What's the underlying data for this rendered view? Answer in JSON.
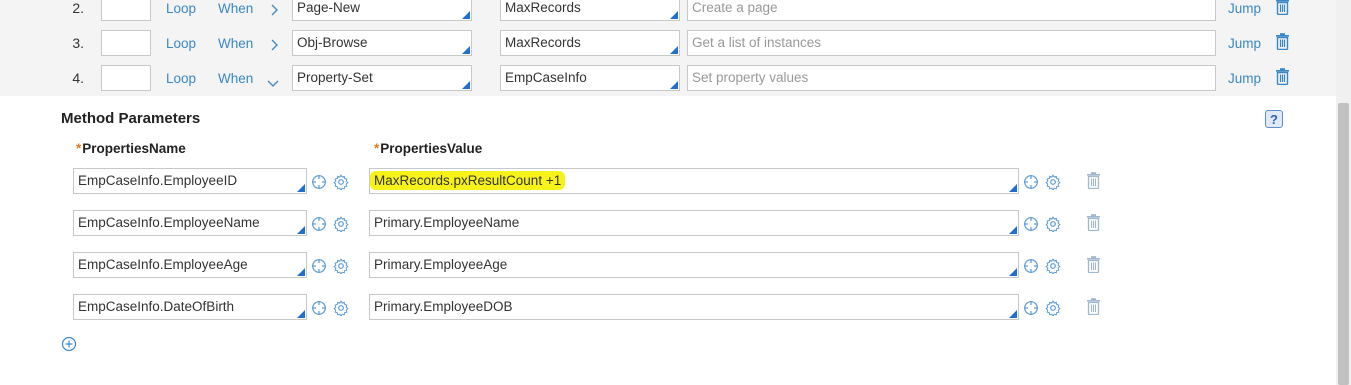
{
  "steps": [
    {
      "num": "2.",
      "loop": "Loop",
      "when": "When",
      "chevron": "right",
      "method": "Page-New",
      "step_page": "MaxRecords",
      "description": "Create a page",
      "jump": "Jump"
    },
    {
      "num": "3.",
      "loop": "Loop",
      "when": "When",
      "chevron": "right",
      "method": "Obj-Browse",
      "step_page": "MaxRecords",
      "description": "Get a list of instances",
      "jump": "Jump"
    },
    {
      "num": "4.",
      "loop": "Loop",
      "when": "When",
      "chevron": "down",
      "method": "Property-Set",
      "step_page": "EmpCaseInfo",
      "description": "Set property values",
      "jump": "Jump"
    }
  ],
  "method_params": {
    "title": "Method Parameters",
    "help": "?",
    "col_name": "PropertiesName",
    "col_value": "PropertiesValue",
    "required_mark": "*",
    "rows": [
      {
        "name": "EmpCaseInfo.EmployeeID",
        "value": "MaxRecords.pxResultCount +1",
        "highlighted": true
      },
      {
        "name": "EmpCaseInfo.EmployeeName",
        "value": "Primary.EmployeeName",
        "highlighted": false
      },
      {
        "name": "EmpCaseInfo.EmployeeAge",
        "value": "Primary.EmployeeAge",
        "highlighted": false
      },
      {
        "name": "EmpCaseInfo.DateOfBirth",
        "value": "Primary.EmployeeDOB",
        "highlighted": false
      }
    ]
  },
  "colors": {
    "accent": "#3a87c8",
    "highlight": "#f7f31a",
    "required": "#e07b1a"
  },
  "icons": {
    "add": "plus-circle-icon",
    "trash": "trash-icon",
    "target": "crosshair-icon",
    "gear": "gear-icon"
  }
}
